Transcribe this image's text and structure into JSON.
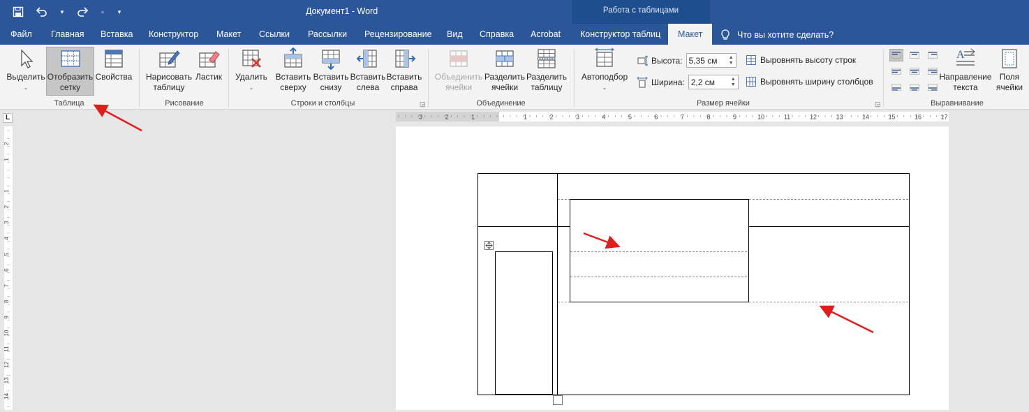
{
  "window": {
    "title": "Документ1  -  Word",
    "context_group": "Работа с таблицами"
  },
  "tabs": [
    {
      "label": "Файл"
    },
    {
      "label": "Главная"
    },
    {
      "label": "Вставка"
    },
    {
      "label": "Конструктор"
    },
    {
      "label": "Макет"
    },
    {
      "label": "Ссылки"
    },
    {
      "label": "Рассылки"
    },
    {
      "label": "Рецензирование"
    },
    {
      "label": "Вид"
    },
    {
      "label": "Справка"
    },
    {
      "label": "Acrobat"
    },
    {
      "label": "Конструктор таблиц"
    },
    {
      "label": "Макет",
      "active": true
    }
  ],
  "tell_me": "Что вы хотите сделать?",
  "ribbon": {
    "table": {
      "label": "Таблица",
      "select": "Выделить",
      "show_grid_1": "Отобразить",
      "show_grid_2": "сетку",
      "properties": "Свойства"
    },
    "draw": {
      "label": "Рисование",
      "draw_table_1": "Нарисовать",
      "draw_table_2": "таблицу",
      "eraser": "Ластик"
    },
    "rows_cols": {
      "label": "Строки и столбцы",
      "delete": "Удалить",
      "insert_above_1": "Вставить",
      "insert_above_2": "сверху",
      "insert_below_1": "Вставить",
      "insert_below_2": "снизу",
      "insert_left_1": "Вставить",
      "insert_left_2": "слева",
      "insert_right_1": "Вставить",
      "insert_right_2": "справа"
    },
    "merge": {
      "label": "Объединение",
      "merge_cells_1": "Объединить",
      "merge_cells_2": "ячейки",
      "split_cells_1": "Разделить",
      "split_cells_2": "ячейки",
      "split_table_1": "Разделить",
      "split_table_2": "таблицу"
    },
    "cell_size": {
      "label": "Размер ячейки",
      "autofit": "Автоподбор",
      "height_label": "Высота:",
      "height_value": "5,35 см",
      "width_label": "Ширина:",
      "width_value": "2,2 см",
      "distribute_rows": "Выровнять высоту строк",
      "distribute_cols": "Выровнять ширину столбцов"
    },
    "alignment": {
      "label": "Выравнивание",
      "text_direction_1": "Направление",
      "text_direction_2": "текста",
      "margins_1": "Поля",
      "margins_2": "ячейки"
    }
  },
  "rulers": {
    "horizontal_ticks": [
      "3",
      "2",
      "1",
      "1",
      "2",
      "3",
      "4",
      "5",
      "6",
      "7",
      "8",
      "9",
      "10",
      "11",
      "12",
      "13",
      "14",
      "15",
      "16",
      "17"
    ],
    "vertical_ticks": [
      "4",
      "3",
      "2",
      "1",
      "1",
      "2",
      "3",
      "4",
      "5",
      "6",
      "7",
      "8",
      "9",
      "10",
      "11",
      "12",
      "13",
      "14"
    ]
  },
  "colors": {
    "title_bar": "#2b579a",
    "context_bar": "#1f4e8f",
    "ribbon": "#f3f3f3",
    "annotation_arrow": "#e01e1e"
  }
}
